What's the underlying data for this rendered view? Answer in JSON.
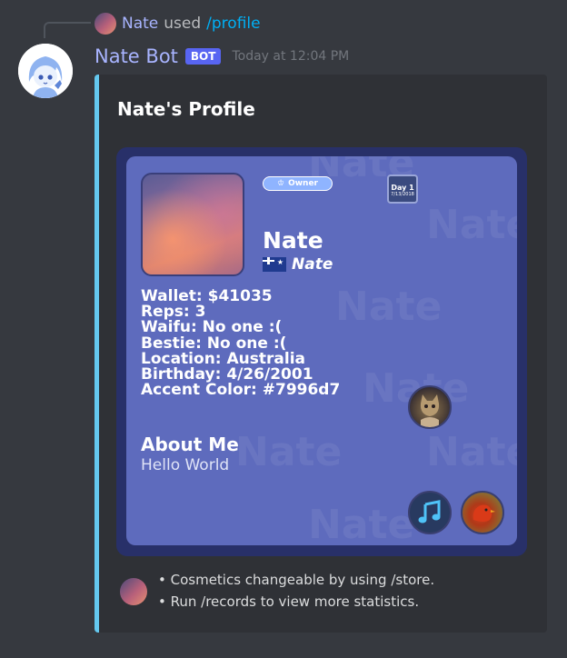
{
  "reply": {
    "user": "Nate",
    "verb": "used",
    "command": "/profile"
  },
  "message": {
    "author": "Nate Bot",
    "tag": "BOT",
    "timestamp": "Today at 12:04 PM"
  },
  "embed": {
    "title": "Nate's Profile",
    "accent_color": "#64c8ef",
    "profile_card": {
      "watermark_text": "Nate",
      "owner_badge": "Owner",
      "day_badge": {
        "label": "Day 1",
        "date": "7/13/2018"
      },
      "name": "Nate",
      "nickname": "Nate",
      "nickname_flag": "australia-flag-icon",
      "stats": [
        "Wallet: $41035",
        "Reps: 3",
        "Waifu: No one :(",
        "Bestie: No one :(",
        "Location: Australia",
        "Birthday: 4/26/2001",
        "Accent Color: #7996d7"
      ],
      "about_heading": "About Me",
      "about_text": "Hello World",
      "card_color": "#5e6bbd",
      "frame_color": "#283069"
    },
    "footer_lines": [
      "• Cosmetics changeable by using /store.",
      "• Run /records to view more statistics."
    ]
  }
}
